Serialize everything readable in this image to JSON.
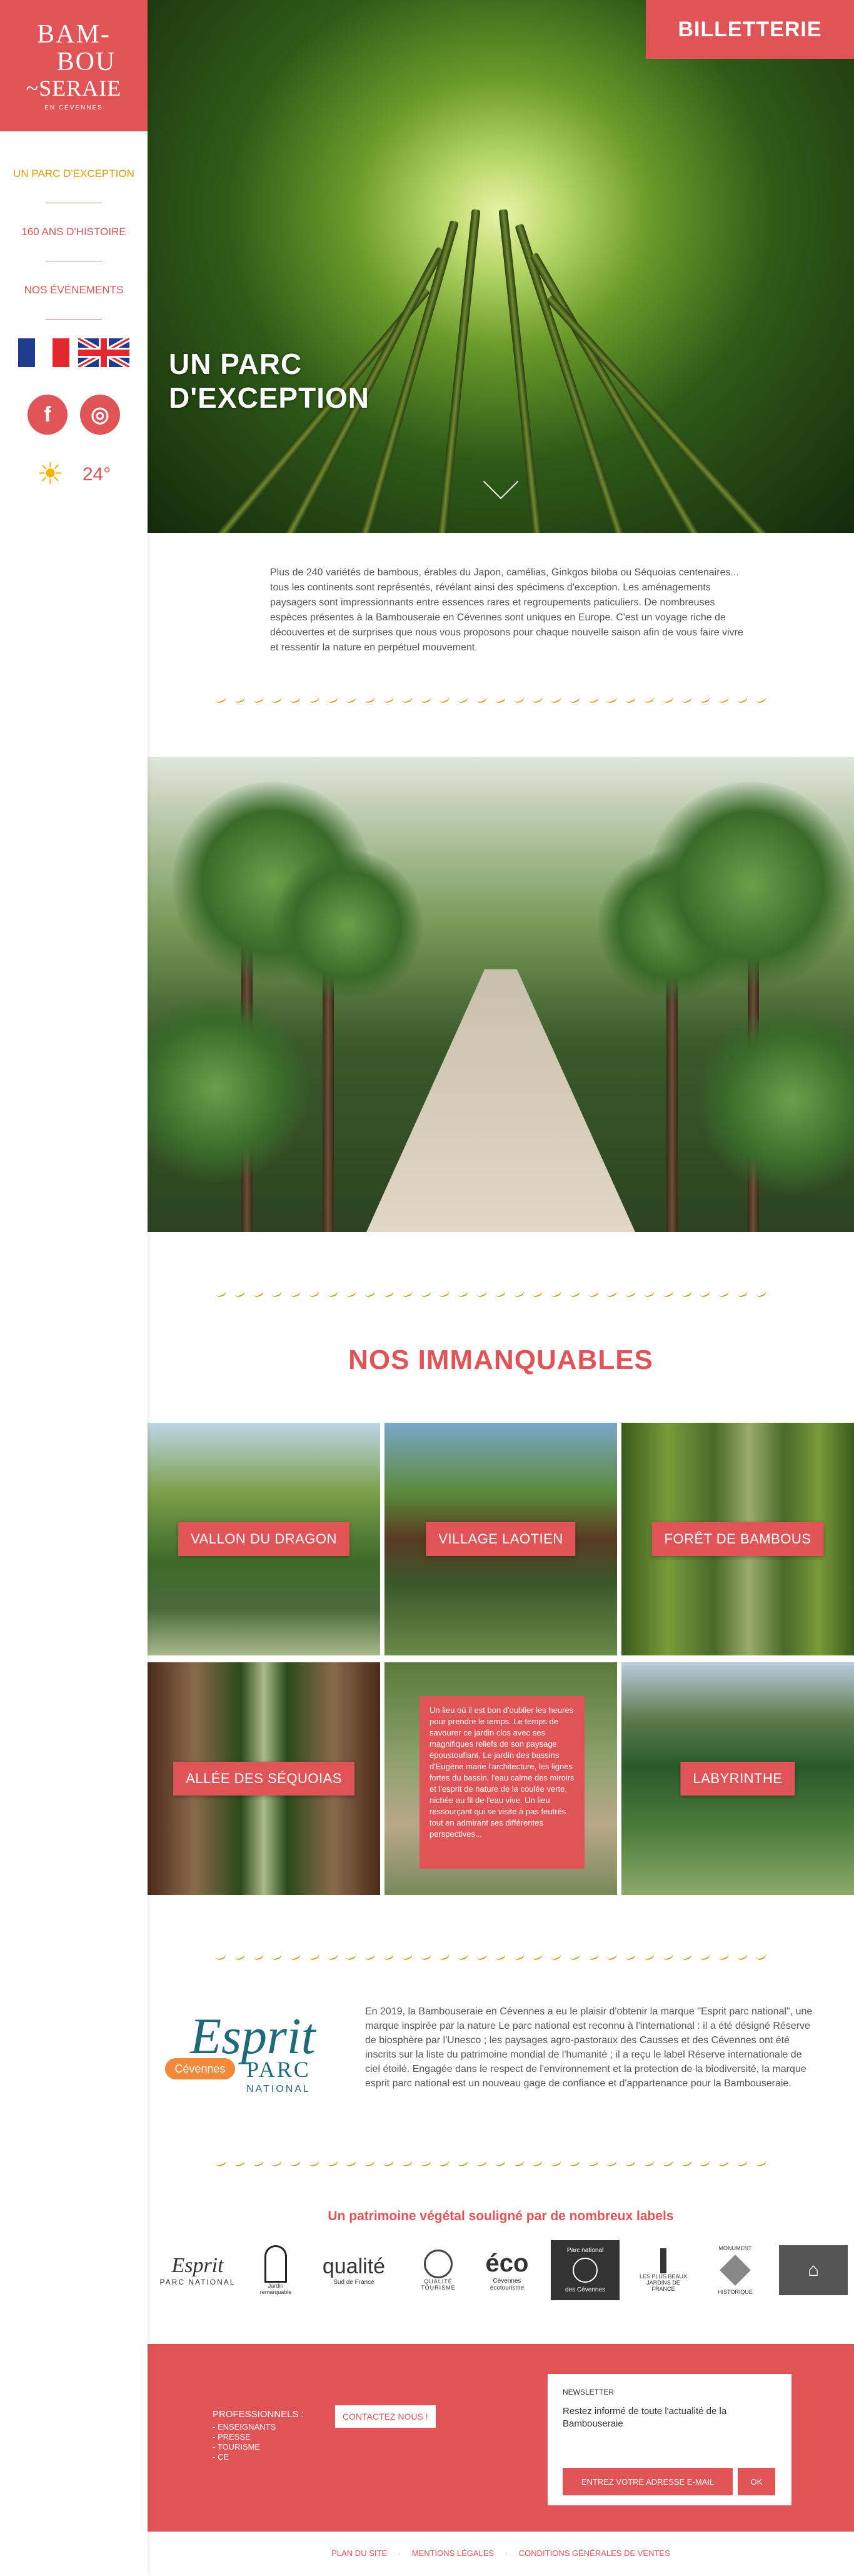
{
  "brand": {
    "logo_line1": "BAM-",
    "logo_line2": "BOU",
    "logo_line3": "~SERAIE",
    "logo_tagline": "EN CÉVENNES"
  },
  "sidebar": {
    "items": [
      {
        "label": "UN PARC D'EXCEPTION",
        "active": true
      },
      {
        "label": "160 ANS D'HISTOIRE",
        "active": false
      },
      {
        "label": "NOS ÉVÉNEMENTS",
        "active": false
      }
    ],
    "languages": [
      "Français",
      "English"
    ],
    "socials": [
      {
        "icon": "facebook-icon",
        "glyph": "f"
      },
      {
        "icon": "instagram-icon",
        "glyph": "◎"
      }
    ],
    "weather": {
      "icon": "sun-icon",
      "glyph": "☀",
      "temperature": "24°"
    }
  },
  "header": {
    "ticket_button": "BILLETTERIE"
  },
  "hero": {
    "title_line1": "UN PARC",
    "title_line2": "D'EXCEPTION"
  },
  "intro": {
    "text": "Plus de 240 variétés de bambous, érables du Japon, camélias, Ginkgos biloba ou Séquoias centenaires... tous les continents sont représentés, révélant ainsi des spécimens d'exception. Les aménagements paysagers sont impressionnants entre essences rares et regroupements paticuliers. De nombreuses espèces présentes à la Bambouseraie en Cévennes sont uniques en Europe. C'est un voyage riche de découvertes et de surprises que nous vous proposons pour chaque nouvelle saison afin de vous faire vivre et ressentir la nature en perpétuel mouvement."
  },
  "highlights": {
    "title": "NOS IMMANQUABLES",
    "tiles": [
      {
        "label": "VALLON DU DRAGON"
      },
      {
        "label": "VILLAGE LAOTIEN"
      },
      {
        "label": "FORÊT DE BAMBOUS"
      },
      {
        "label": "ALLÉE DES SÉQUOIAS"
      },
      {
        "text": "Un lieu où il est bon d'oublier les heures pour prendre le temps. Le temps de savourer ce jardin clos avec ses magnifiques reliefs de son paysage époustouflant. Le jardin des bassins d'Eugène marie l'architecture, les lignes fortes du bassin, l'eau calme des miroirs et l'esprit de nature de la coulée verte, nichée au fil de l'eau vive. Un lieu ressourçant qui se visite à pas feutrés tout en admirant ses différentes perspectives..."
      },
      {
        "label": "LABYRINTHE"
      }
    ]
  },
  "esprit_parc": {
    "logo_word1": "Esprit",
    "logo_badge": "Cévennes",
    "logo_word2": "PARC",
    "logo_word3": "NATIONAL",
    "text": "En 2019, la Bambouseraie en Cévennes a eu le plaisir d'obtenir la marque \"Esprit parc national\", une marque inspirée par la nature Le parc national est reconnu à l'international : il a été désigné Réserve de biosphère par l'Unesco ; les paysages agro-pastoraux des Causses et des Cévennes ont été inscrits sur la liste du patrimoine mondial de l'humanité ; il a reçu le label Réserve internationale de ciel étoilé. Engagée dans le respect de l'environnement et la protection de la biodiversité, la marque esprit parc national est un nouveau gage de confiance et d'appartenance pour la Bambouseraie."
  },
  "labels": {
    "title": "Un patrimoine végétal souligné par de nombreux labels",
    "items": [
      {
        "name": "Esprit PARC NATIONAL",
        "icon": "esprit-parc-logo"
      },
      {
        "name": "Jardin remarquable",
        "icon": "jardin-remarquable-logo"
      },
      {
        "name": "qualité Sud de France",
        "icon": "qualite-sud-de-france-logo"
      },
      {
        "name": "QUALITÉ TOURISME",
        "icon": "qualite-tourisme-logo"
      },
      {
        "name": "Cévennes écotourisme",
        "icon": "cevennes-ecotourisme-logo"
      },
      {
        "name": "Parc national des Cévennes",
        "icon": "parc-national-logo"
      },
      {
        "name": "LES PLUS BEAUX JARDINS DE FRANCE",
        "icon": "plus-beaux-jardins-logo"
      },
      {
        "name": "MONUMENT HISTORIQUE",
        "icon": "monument-historique-logo"
      },
      {
        "name": "Maison",
        "icon": "maison-logo"
      }
    ]
  },
  "footer": {
    "pros_title": "PROFESSIONNELS :",
    "pros_links": [
      "- ENSEIGNANTS",
      "- PRESSE",
      "- TOURISME",
      "- CE"
    ],
    "contact_button": "CONTACTEZ NOUS !",
    "newsletter": {
      "heading": "NEWSLETTER",
      "text": "Restez informé de toute l'actualité de la Bambouseraie",
      "placeholder": "ENTREZ VOTRE ADRESSE E-MAIL",
      "submit": "OK"
    },
    "bottom_links": [
      "PLAN DU SITE",
      "MENTIONS LÉGALES",
      "CONDITIONS GÉNÉRALES DE VENTES"
    ]
  },
  "colors": {
    "brand_red": "#e05457",
    "active_gold": "#d9a010",
    "sun_yellow": "#f2b50c"
  }
}
